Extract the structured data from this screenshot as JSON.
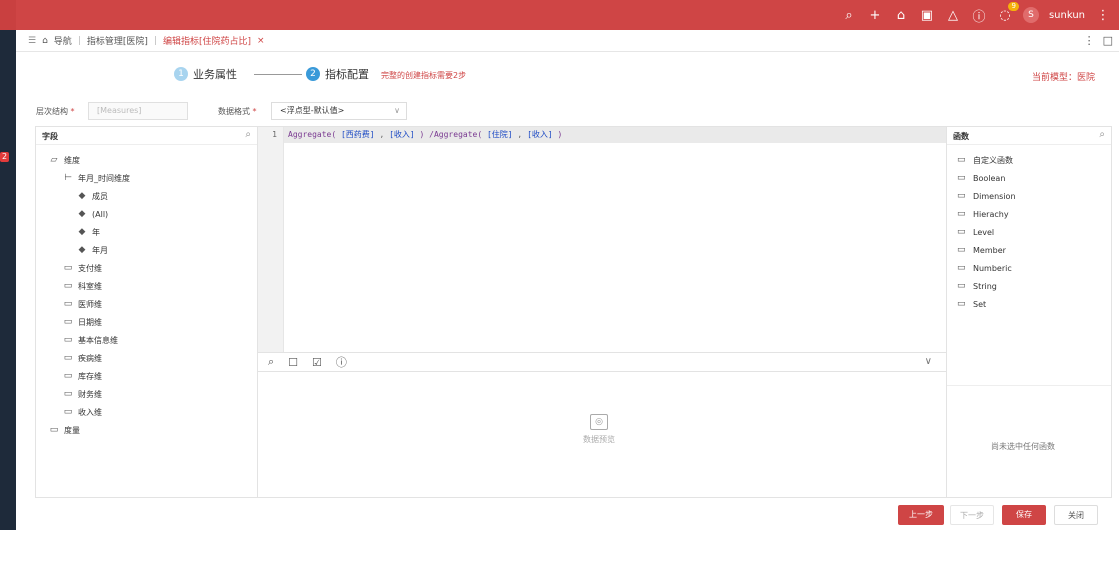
{
  "colors": {
    "brand": "#cf4545",
    "step_active": "#3a9ad9",
    "sidebar": "#1e2a3a"
  },
  "sidebar": {
    "badge": "2"
  },
  "header": {
    "icons": [
      "search-icon",
      "plus-icon",
      "home-icon",
      "lock-icon",
      "bell-icon",
      "help-icon",
      "message-icon"
    ],
    "message_badge": "9",
    "avatar_letter": "S",
    "username": "sunkun",
    "more": "⋮"
  },
  "tabs": {
    "menu_icon": "☰",
    "home_label": "导航",
    "breadcrumb": "指标管理[医院]",
    "active_tab": "编辑指标[住院药占比]",
    "close": "×"
  },
  "steps": [
    {
      "num": "1",
      "label": "业务属性"
    },
    {
      "num": "2",
      "label": "指标配置"
    }
  ],
  "step_hint": "完整的创建指标需要2步",
  "current_model": "当前模型：医院",
  "form": {
    "hierarchy_label": "层次结构",
    "hierarchy_placeholder": "[Measures]",
    "format_label": "数据格式",
    "format_value": "<浮点型-默认值>",
    "required_mark": "*"
  },
  "fields_panel": {
    "title": "字段",
    "tree": [
      {
        "label": "维度",
        "icon": "folder-open-icon",
        "level": 0
      },
      {
        "label": "年月_时间维度",
        "icon": "hierarchy-icon",
        "level": 1
      },
      {
        "label": "成员",
        "icon": "layers-icon",
        "level": 2
      },
      {
        "label": "(All)",
        "icon": "layers-icon",
        "level": 2
      },
      {
        "label": "年",
        "icon": "layers-icon",
        "level": 2
      },
      {
        "label": "年月",
        "icon": "layers-icon",
        "level": 2
      },
      {
        "label": "支付维",
        "icon": "folder-icon",
        "level": 1
      },
      {
        "label": "科室维",
        "icon": "folder-icon",
        "level": 1
      },
      {
        "label": "医师维",
        "icon": "folder-icon",
        "level": 1
      },
      {
        "label": "日期维",
        "icon": "folder-icon",
        "level": 1
      },
      {
        "label": "基本信息维",
        "icon": "folder-icon",
        "level": 1
      },
      {
        "label": "疾病维",
        "icon": "folder-icon",
        "level": 1
      },
      {
        "label": "库存维",
        "icon": "folder-icon",
        "level": 1
      },
      {
        "label": "财务维",
        "icon": "folder-icon",
        "level": 1
      },
      {
        "label": "收入维",
        "icon": "folder-icon",
        "level": 1
      },
      {
        "label": "度量",
        "icon": "folder-icon",
        "level": 0
      }
    ]
  },
  "editor": {
    "line_number": "1",
    "tokens": [
      {
        "t": "fn",
        "text": "Aggregate( "
      },
      {
        "t": "br",
        "text": "[西药费]"
      },
      {
        "t": "pl",
        "text": " , "
      },
      {
        "t": "br",
        "text": "[收入]"
      },
      {
        "t": "fn",
        "text": " ) /Aggregate( "
      },
      {
        "t": "br",
        "text": "[住院]"
      },
      {
        "t": "pl",
        "text": " , "
      },
      {
        "t": "br",
        "text": "[收入]"
      },
      {
        "t": "fn",
        "text": " )"
      }
    ]
  },
  "editor_toolbar": {
    "icons": [
      "preview-icon",
      "format-icon",
      "validate-icon",
      "help-icon"
    ],
    "collapse_icon": "chevron-down-icon"
  },
  "preview": {
    "label": "数据预览"
  },
  "functions_panel": {
    "title": "函数",
    "items": [
      "自定义函数",
      "Boolean",
      "Dimension",
      "Hierachy",
      "Level",
      "Member",
      "Numberic",
      "String",
      "Set"
    ],
    "empty_text": "尚未选中任何函数"
  },
  "footer": {
    "prev": "上一步",
    "next": "下一步",
    "save": "保存",
    "close": "关闭"
  }
}
